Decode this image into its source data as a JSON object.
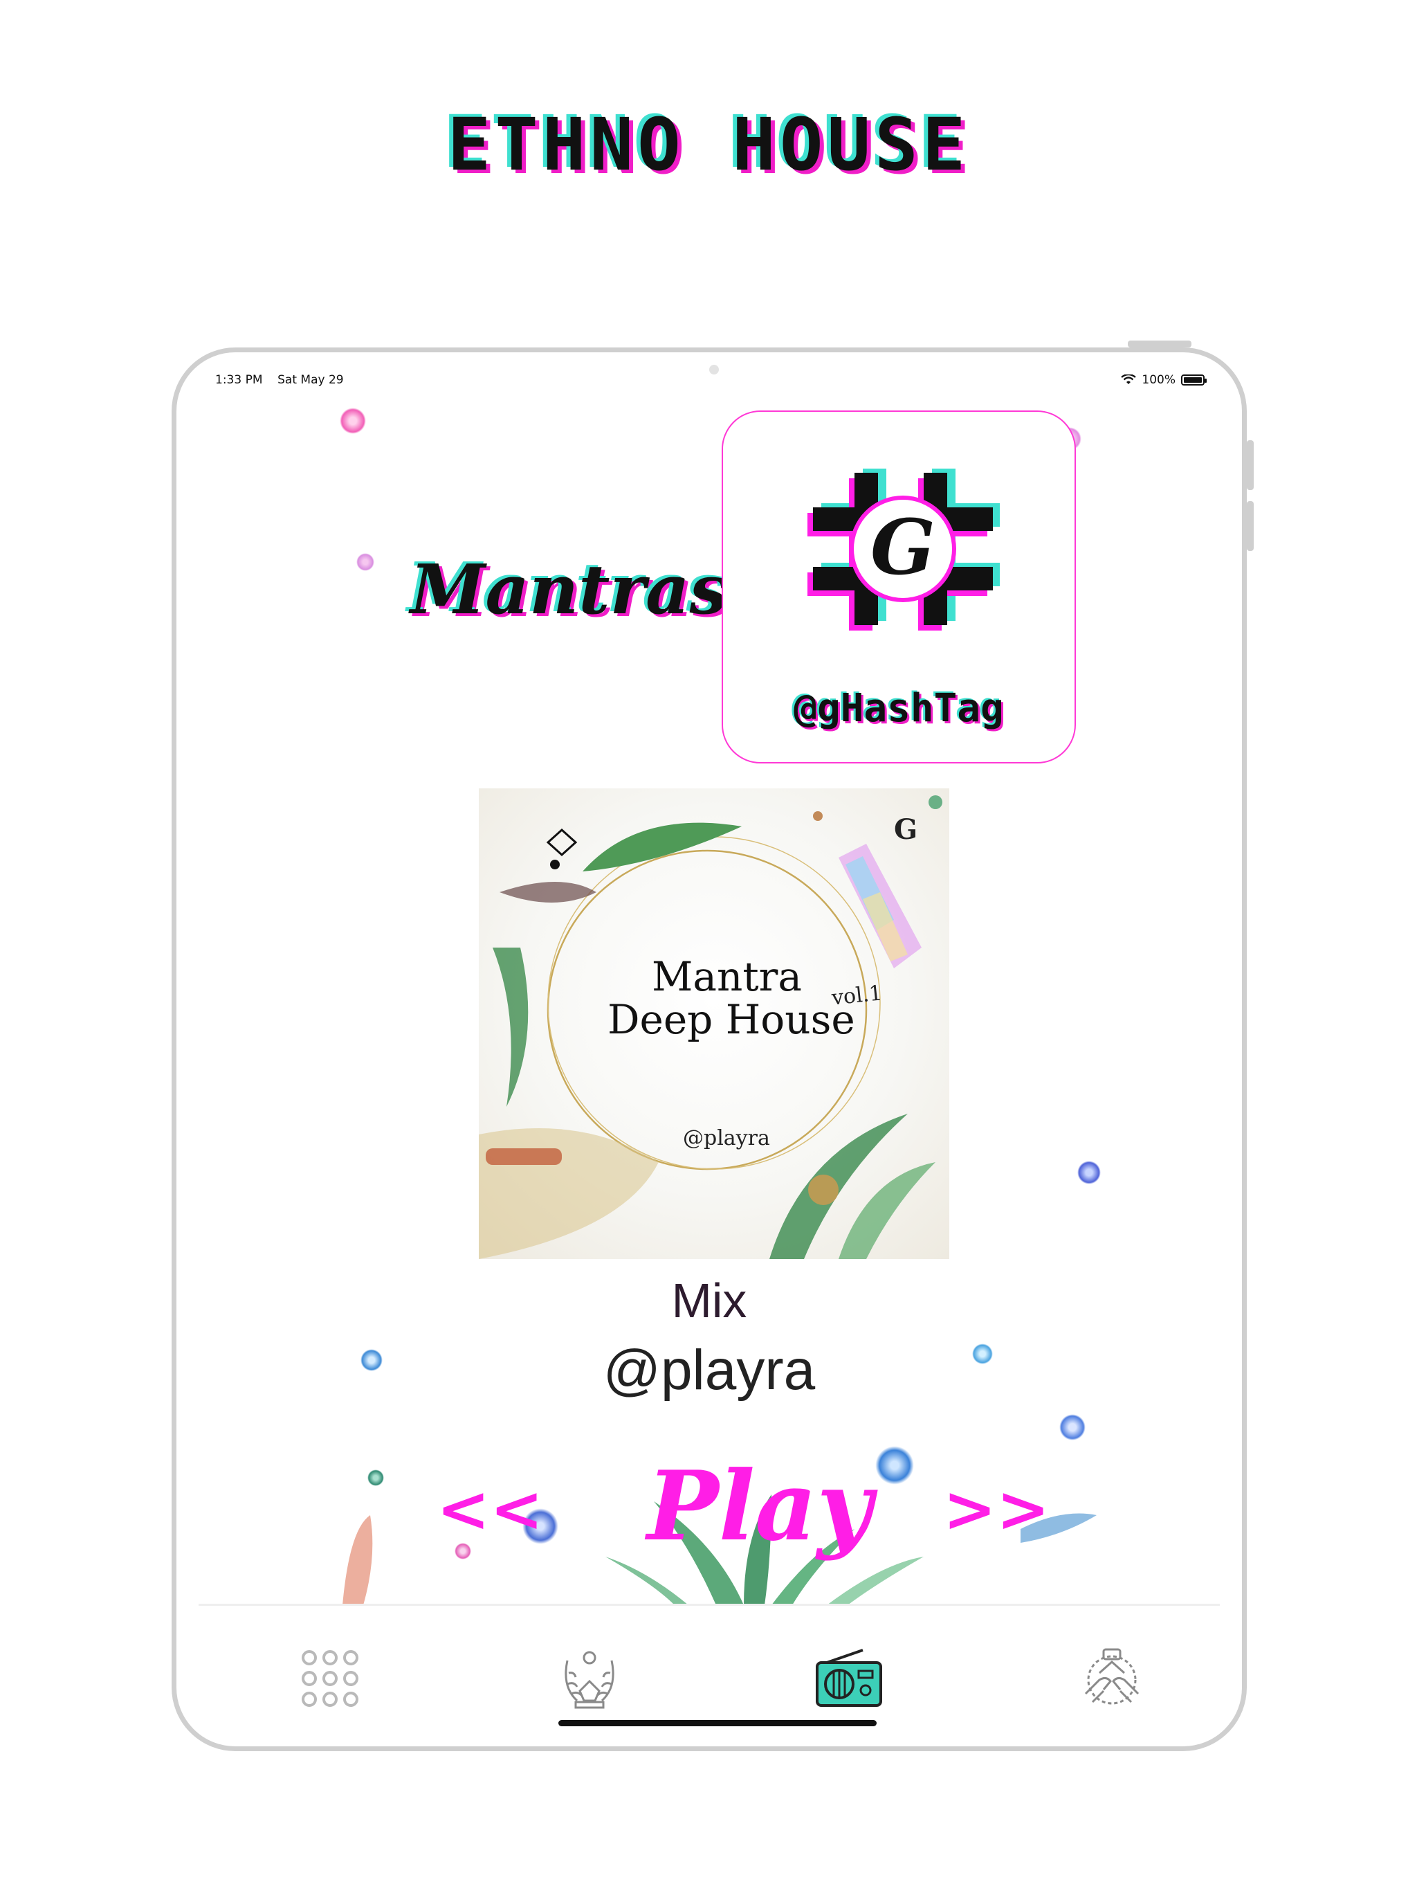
{
  "banner": {
    "title": "ETHNO HOUSE"
  },
  "status_bar": {
    "time": "1:33 PM",
    "date": "Sat May 29",
    "battery": "100%"
  },
  "screen": {
    "section_title": "Mantras",
    "logo": {
      "handle": "@gHashTag",
      "letter": "G"
    },
    "album": {
      "title_line1": "Mantra",
      "title_line2": "Deep House",
      "volume": "vol.1",
      "artist": "@playra",
      "corner_mark": "G"
    },
    "mix_label": "Mix",
    "mix_artist": "@playra",
    "controls": {
      "prev": "<<",
      "play": "Play",
      "next": ">>"
    }
  },
  "tab_bar": {
    "tabs": [
      {
        "name": "grid",
        "icon": "grid-icon"
      },
      {
        "name": "awards",
        "icon": "laurel-icon"
      },
      {
        "name": "radio",
        "icon": "radio-icon",
        "active": true
      },
      {
        "name": "community",
        "icon": "hands-icon"
      }
    ]
  },
  "colors": {
    "accent_pink": "#ff1ee6",
    "glitch_cyan": "#3fe0d0",
    "glitch_magenta": "#f01ec8",
    "radio_teal": "#3ccfb8"
  }
}
